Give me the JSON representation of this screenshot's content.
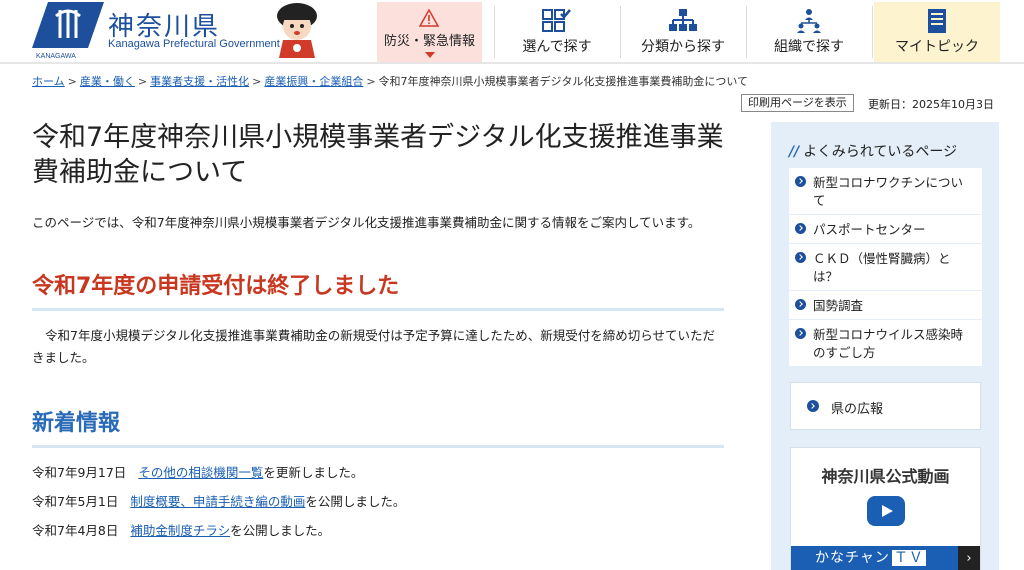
{
  "header": {
    "logo_ja": "神奈川県",
    "logo_en": "Kanagawa Prefectural Government",
    "emblem_caption": "KANAGAWA",
    "nav": {
      "emergency": "防災・緊急情報",
      "choose": "選んで探す",
      "category": "分類から探す",
      "organization": "組織で探す",
      "mytopic": "マイトピック"
    }
  },
  "breadcrumb": {
    "items": [
      "ホーム",
      "産業・働く",
      "事業者支援・活性化",
      "産業振興・企業組合"
    ],
    "current": "令和7年度神奈川県小規模事業者デジタル化支援推進事業費補助金について"
  },
  "page_tools": {
    "print_label": "印刷用ページを表示",
    "updated": "更新日：2025年10月3日"
  },
  "main": {
    "title": "令和7年度神奈川県小規模事業者デジタル化支援推進事業費補助金について",
    "intro": "このページでは、令和7年度神奈川県小規模事業者デジタル化支援推進事業費補助金に関する情報をご案内しています。",
    "notice_heading": "令和7年度の申請受付は終了しました",
    "notice_text": "令和7年度小規模デジタル化支援推進事業費補助金の新規受付は予定予算に達したため、新規受付を締め切らせていただきました。",
    "news_heading": "新着情報",
    "news": [
      {
        "date": "令和7年9月17日",
        "link": "その他の相談機関一覧",
        "suffix": "を更新しました。"
      },
      {
        "date": "令和7年5月1日",
        "link": "制度概要、申請手続き編の動画",
        "suffix": "を公開しました。"
      },
      {
        "date": "令和7年4月8日",
        "link": "補助金制度チラシ",
        "suffix": "を公開しました。"
      }
    ]
  },
  "sidebar": {
    "heading": "よくみられているページ",
    "items": [
      "新型コロナワクチンについて",
      "パスポートセンター",
      "ＣＫＤ（慢性腎臓病）とは？",
      "国勢調査",
      "新型コロナウイルス感染時のすごし方"
    ],
    "pr_label": "県の広報",
    "video_title": "神奈川県公式動画",
    "video_banner": "かなチャン",
    "video_banner_tv": "ＴＶ"
  },
  "colors": {
    "brand": "#1d4f9c",
    "link": "#1a5fb4",
    "notice_red": "#c8371f",
    "sidebar_bg": "#e3eef8",
    "emergency_bg": "#fbe0dc",
    "mytopic_bg": "#fdf3cf"
  },
  "icons": [
    "kanagawa-emblem",
    "mascot",
    "warning-icon",
    "checklist-icon",
    "hierarchy-icon",
    "organization-icon",
    "notebook-icon",
    "chevron-right-icon",
    "play-icon"
  ]
}
